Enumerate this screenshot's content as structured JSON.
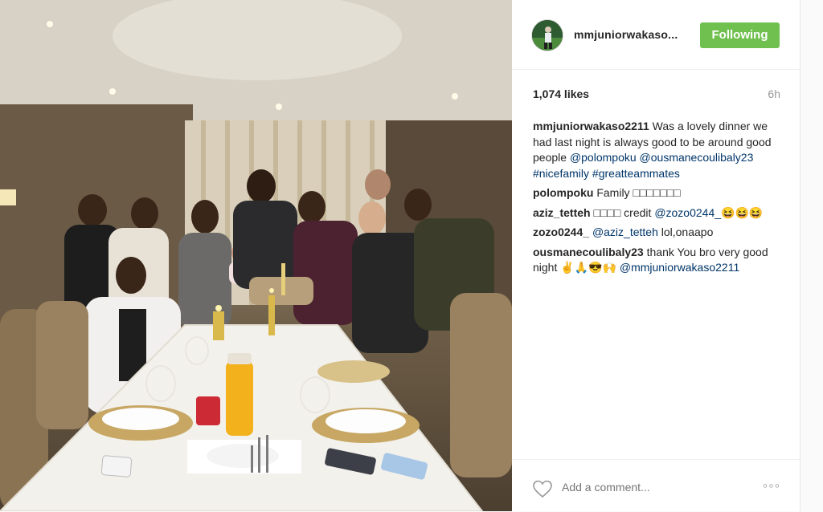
{
  "post": {
    "username": "mmjuniorwakaso...",
    "follow_label": "Following",
    "likes": "1,074 likes",
    "time": "6h",
    "photo_alt": "group dinner photo"
  },
  "comments": [
    {
      "user": "mmjuniorwakaso2211",
      "text": " Was a lovely dinner we had last night is always good to be around good people ",
      "links": [
        "@polompoku",
        "@ousmanecoulibaly23",
        "#nicefamily",
        "#greatteammates"
      ]
    },
    {
      "user": "polompoku",
      "text": " Family □□□□□□□",
      "links": []
    },
    {
      "user": "aziz_tetteh",
      "text": " □□□□ credit ",
      "links": [
        "@zozo0244_"
      ],
      "tail": "😆😆😆"
    },
    {
      "user": "zozo0244_",
      "text": " ",
      "links": [
        "@aziz_tetteh"
      ],
      "tail": " lol,onaapo"
    },
    {
      "user": "ousmanecoulibaly23",
      "text": " thank You bro very good night ✌️🙏😎🙌 ",
      "links": [
        "@mmjuniorwakaso2211"
      ]
    }
  ],
  "footer": {
    "add_comment_placeholder": "Add a comment...",
    "more_label": "◦◦◦"
  },
  "icons": {
    "heart": "heart-icon",
    "avatar": "avatar"
  },
  "colors": {
    "follow_green": "#70c050",
    "link_blue": "#003569",
    "text_dark": "#262626",
    "text_gray": "#999999"
  }
}
